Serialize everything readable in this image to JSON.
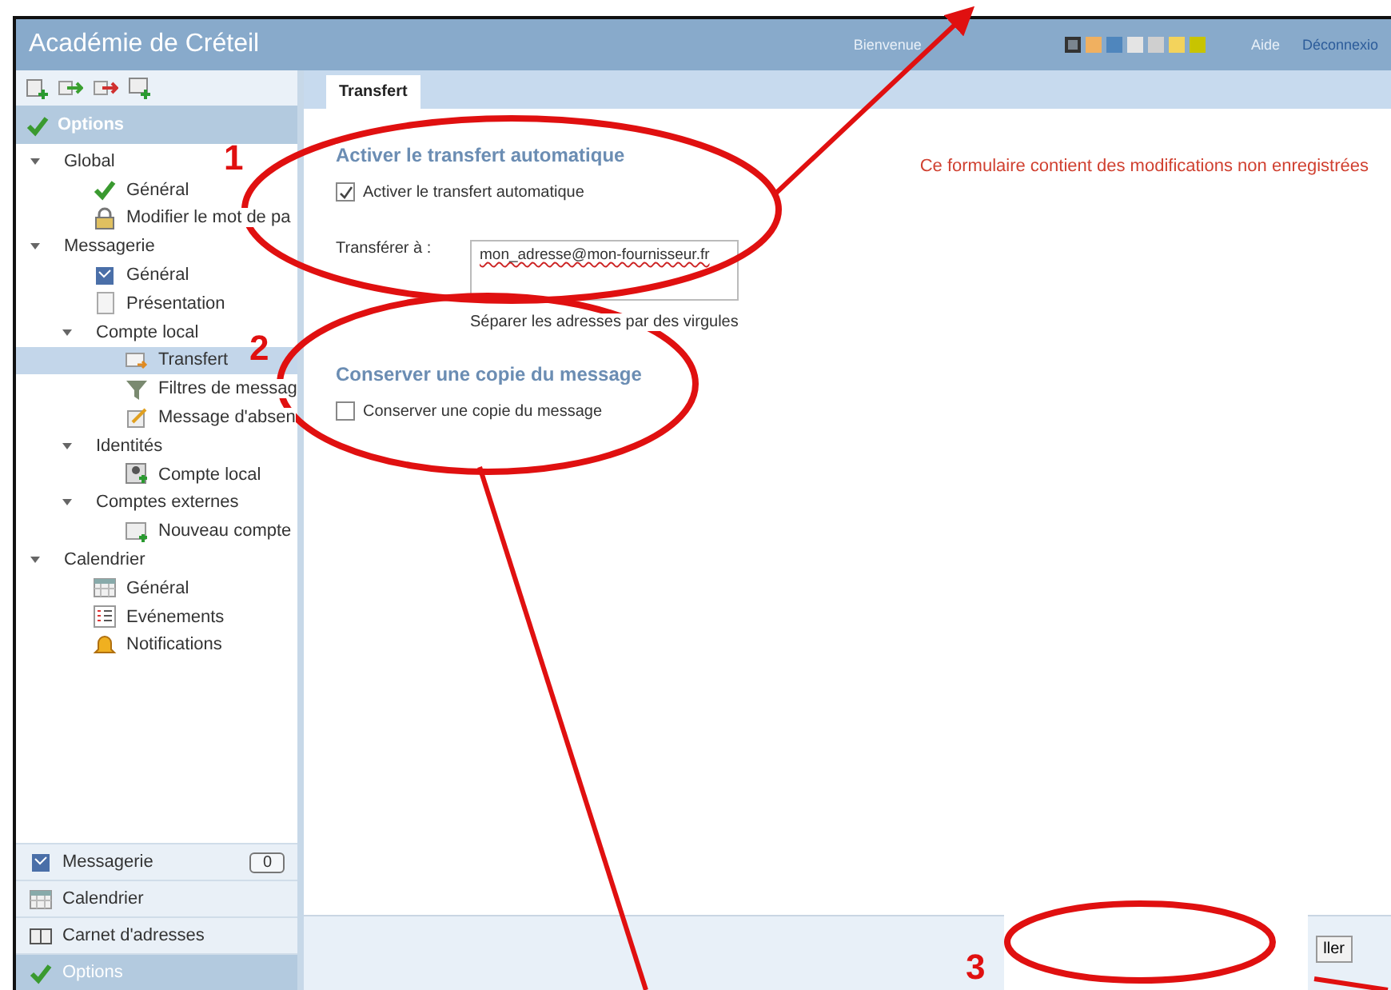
{
  "header": {
    "title": "Académie de Créteil",
    "welcome": "Bienvenue",
    "theme_swatches": [
      {
        "color": "#7a8590",
        "selected": true
      },
      {
        "color": "#f0b060",
        "selected": false
      },
      {
        "color": "#4f86bd",
        "selected": false
      },
      {
        "color": "#e4e4e4",
        "selected": false
      },
      {
        "color": "#cfcfcf",
        "selected": false
      },
      {
        "color": "#f3d35c",
        "selected": false
      },
      {
        "color": "#c8c400",
        "selected": false
      }
    ],
    "links": [
      "Aide",
      "Déconnexio"
    ]
  },
  "sidebar": {
    "section_title": "Options",
    "tree": [
      {
        "label": "Global",
        "expanded": true,
        "children": [
          {
            "label": "Général",
            "kind": "check",
            "selected": false
          },
          {
            "label": "Modifier le mot de pa",
            "kind": "lock",
            "selected": false
          }
        ]
      },
      {
        "label": "Messagerie",
        "expanded": true,
        "children": [
          {
            "label": "Général",
            "kind": "mail",
            "selected": false
          },
          {
            "label": "Présentation",
            "kind": "page",
            "selected": false
          },
          {
            "label": "Compte local",
            "expanded": true,
            "children": [
              {
                "label": "Transfert",
                "kind": "forward",
                "selected": true
              },
              {
                "label": "Filtres de messag",
                "kind": "filter",
                "selected": false
              },
              {
                "label": "Message d'absen",
                "kind": "note",
                "selected": false
              }
            ]
          },
          {
            "label": "Identités",
            "expanded": true,
            "children": [
              {
                "label": "Compte local",
                "kind": "contact",
                "selected": false
              }
            ]
          },
          {
            "label": "Comptes externes",
            "expanded": true,
            "children": [
              {
                "label": "Nouveau compte",
                "kind": "newaccount",
                "selected": false
              }
            ]
          }
        ]
      },
      {
        "label": "Calendrier",
        "expanded": true,
        "children": [
          {
            "label": "Général",
            "kind": "calendar",
            "selected": false
          },
          {
            "label": "Evénements",
            "kind": "list",
            "selected": false
          },
          {
            "label": "Notifications",
            "kind": "bell",
            "selected": false
          }
        ]
      }
    ],
    "nav": [
      {
        "label": "Messagerie",
        "kind": "mail",
        "badge": "0",
        "selected": false
      },
      {
        "label": "Calendrier",
        "kind": "calendar",
        "selected": false
      },
      {
        "label": "Carnet d'adresses",
        "kind": "book",
        "selected": false
      },
      {
        "label": "Options",
        "kind": "check",
        "selected": true
      }
    ]
  },
  "tabs": [
    {
      "label": "Transfert",
      "selected": true
    }
  ],
  "sections": [
    {
      "title": "Activer le transfert automatique",
      "checkbox": {
        "label": "Activer le transfert automatique",
        "checked": true
      },
      "field": {
        "label": "Transférer à :",
        "value": "mon_adresse@mon-fournisseur.fr",
        "hint": "Séparer les adresses par des virgules"
      }
    },
    {
      "title": "Conserver une copie du message",
      "checkbox": {
        "label": "Conserver une copie du message",
        "checked": false
      }
    }
  ],
  "notice": "Ce formulaire contient des modifications non enregistrées",
  "footer_button": "ller",
  "annotations": [
    "1",
    "2",
    "3"
  ]
}
